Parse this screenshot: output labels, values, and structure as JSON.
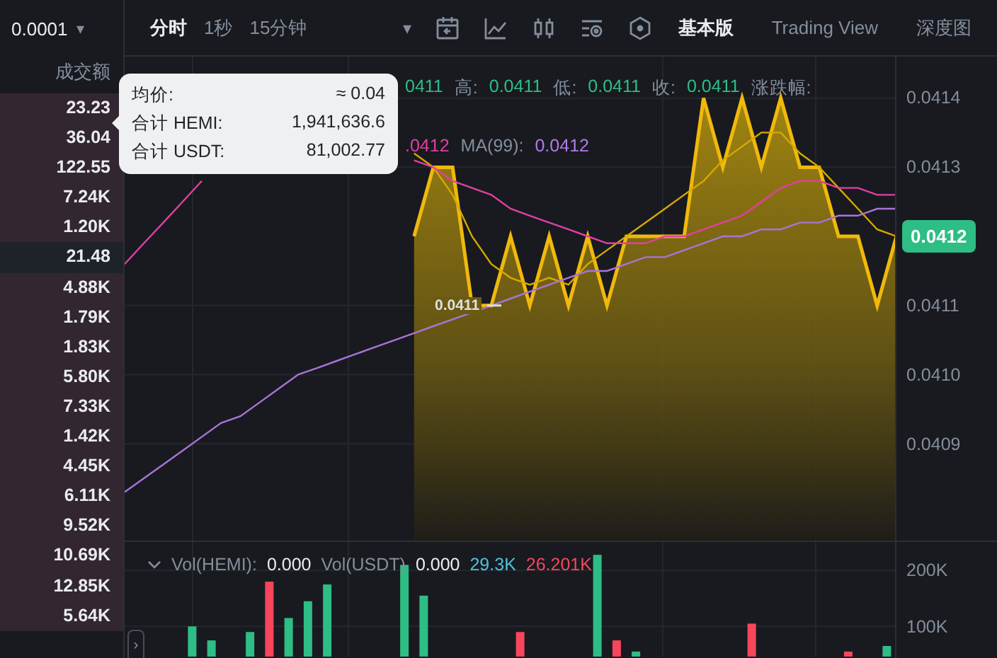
{
  "precision": {
    "value": "0.0001",
    "caret": "▾"
  },
  "trades": {
    "column": "成交额",
    "rows": [
      {
        "value": "23.23",
        "selected": false
      },
      {
        "value": "36.04",
        "selected": false
      },
      {
        "value": "122.55",
        "selected": false
      },
      {
        "value": "7.24K",
        "selected": false
      },
      {
        "value": "1.20K",
        "selected": false
      },
      {
        "value": "21.48",
        "selected": true
      },
      {
        "value": "4.88K",
        "selected": false
      },
      {
        "value": "1.79K",
        "selected": false
      },
      {
        "value": "1.83K",
        "selected": false
      },
      {
        "value": "5.80K",
        "selected": false
      },
      {
        "value": "7.33K",
        "selected": false
      },
      {
        "value": "1.42K",
        "selected": false
      },
      {
        "value": "4.45K",
        "selected": false
      },
      {
        "value": "6.11K",
        "selected": false
      },
      {
        "value": "9.52K",
        "selected": false
      },
      {
        "value": "10.69K",
        "selected": false
      },
      {
        "value": "12.85K",
        "selected": false
      },
      {
        "value": "5.64K",
        "selected": false
      }
    ]
  },
  "intervals": [
    {
      "label": "分时",
      "selected": true
    },
    {
      "label": "1秒",
      "selected": false
    },
    {
      "label": "15分钟",
      "selected": false
    }
  ],
  "interval_caret": "▾",
  "tools": [
    {
      "kind": "calendar"
    },
    {
      "kind": "indicator"
    },
    {
      "kind": "candles"
    },
    {
      "kind": "settings"
    },
    {
      "kind": "hexagon"
    }
  ],
  "views": [
    {
      "label": "基本版",
      "selected": true
    },
    {
      "label": "Trading View",
      "selected": false
    },
    {
      "label": "深度图",
      "selected": false
    }
  ],
  "legend_rows": [
    [
      {
        "text": "0411",
        "color": "#2ebd85"
      },
      {
        "text": "高:",
        "color": "#848e9c"
      },
      {
        "text": "0.0411",
        "color": "#2ebd85"
      },
      {
        "text": "低:",
        "color": "#848e9c"
      },
      {
        "text": "0.0411",
        "color": "#2ebd85"
      },
      {
        "text": "收:",
        "color": "#848e9c"
      },
      {
        "text": "0.0411",
        "color": "#2ebd85"
      },
      {
        "text": "涨跌幅:",
        "color": "#848e9c"
      }
    ],
    [
      {
        "text": ".0412",
        "color": "#e040a0"
      },
      {
        "text": "MA(99):",
        "color": "#848e9c"
      },
      {
        "text": "0.0412",
        "color": "#b07ce8"
      }
    ]
  ],
  "tooltip": {
    "rows": [
      {
        "label": "均价:",
        "value": "≈ 0.04"
      },
      {
        "label": "合计 HEMI:",
        "value": "1,941,636.6"
      },
      {
        "label": "合计 USDT:",
        "value": "81,002.77"
      }
    ]
  },
  "last_price_label": "0.0411",
  "current_price": "0.0412",
  "price_chart": {
    "chart_data": {
      "type": "area",
      "grid": true,
      "ylim": [
        0.04076,
        0.04146
      ],
      "yticks": [
        {
          "value": 0.0414,
          "label": "0.0414"
        },
        {
          "value": 0.0413,
          "label": "0.0413"
        },
        {
          "value": 0.0411,
          "label": "0.0411"
        },
        {
          "value": 0.041,
          "label": "0.0410"
        },
        {
          "value": 0.0409,
          "label": "0.0409"
        }
      ],
      "series": [
        {
          "color": "#f0b90b",
          "values": [
            null,
            null,
            null,
            null,
            null,
            null,
            null,
            null,
            null,
            null,
            null,
            null,
            null,
            null,
            null,
            0.0412,
            0.0413,
            0.0413,
            0.0411,
            0.0411,
            0.0412,
            0.0411,
            0.0412,
            0.0411,
            0.0412,
            0.0411,
            0.0412,
            0.0412,
            0.0412,
            0.0412,
            0.0414,
            0.0413,
            0.0414,
            0.0413,
            0.0414,
            0.0413,
            0.0413,
            0.0412,
            0.0412,
            0.0411,
            0.0412
          ]
        },
        {
          "type": "line",
          "color": "#d8a800",
          "values": [
            null,
            null,
            null,
            null,
            null,
            null,
            null,
            null,
            null,
            null,
            null,
            null,
            null,
            null,
            null,
            0.04132,
            0.0413,
            0.04126,
            0.0412,
            0.04116,
            0.04114,
            0.04113,
            0.04114,
            0.04113,
            0.04116,
            0.04118,
            0.0412,
            0.04122,
            0.04124,
            0.04126,
            0.04128,
            0.04131,
            0.04133,
            0.04135,
            0.04135,
            0.04132,
            0.0413,
            0.04127,
            0.04124,
            0.04121,
            0.0412
          ]
        },
        {
          "type": "line",
          "color": "#e040a0",
          "values": [
            0.04116,
            0.04119,
            0.04122,
            0.04125,
            0.04128,
            null,
            null,
            null,
            null,
            null,
            null,
            null,
            null,
            null,
            null,
            0.04131,
            0.0413,
            0.04128,
            0.04127,
            0.04126,
            0.04124,
            0.04123,
            0.04122,
            0.04121,
            0.0412,
            0.04119,
            0.04119,
            0.04119,
            0.0412,
            0.0412,
            0.04121,
            0.04122,
            0.04123,
            0.04125,
            0.04127,
            0.04128,
            0.04128,
            0.04127,
            0.04127,
            0.04126,
            0.04126
          ]
        },
        {
          "type": "line",
          "color": "#a874d8",
          "values": [
            0.04083,
            0.04085,
            0.04087,
            0.04089,
            0.04091,
            0.04093,
            0.04094,
            0.04096,
            0.04098,
            0.041,
            0.04101,
            0.04102,
            0.04103,
            0.04104,
            0.04105,
            0.04106,
            0.04107,
            0.04108,
            0.04109,
            0.0411,
            0.04111,
            0.04112,
            0.04113,
            0.04114,
            0.04115,
            0.04115,
            0.04116,
            0.04117,
            0.04117,
            0.04118,
            0.04119,
            0.0412,
            0.0412,
            0.04121,
            0.04121,
            0.04122,
            0.04122,
            0.04123,
            0.04123,
            0.04124,
            0.04124
          ]
        }
      ]
    }
  },
  "volume": {
    "legend": [
      {
        "text": "Vol(HEMI):",
        "color": "#848e9c"
      },
      {
        "text": "0.000",
        "color": "#eaecef"
      },
      {
        "text": "Vol(USDT)",
        "color": "#848e9c"
      },
      {
        "text": "0.000",
        "color": "#eaecef"
      },
      {
        "text": "29.3K",
        "color": "#4fc3dc"
      },
      {
        "text": "26.201K",
        "color": "#f6465d"
      }
    ],
    "chart_data": {
      "type": "bar",
      "grid": true,
      "ylim": [
        46000,
        251000
      ],
      "yticks": [
        {
          "value": 200000,
          "label": "200K"
        },
        {
          "value": 100000,
          "label": "100K"
        }
      ],
      "series": [
        {
          "color": "#2ebd85",
          "values": [
            null,
            null,
            null,
            100000,
            75000,
            null,
            90000,
            null,
            115000,
            145000,
            175000,
            null,
            null,
            null,
            210000,
            155000,
            null,
            null,
            null,
            null,
            null,
            null,
            null,
            null,
            228000,
            null,
            55000,
            null,
            null,
            null,
            null,
            null,
            null,
            null,
            null,
            null,
            null,
            null,
            null,
            65000
          ]
        },
        {
          "color": "#f6465d",
          "values": [
            null,
            null,
            null,
            null,
            null,
            null,
            null,
            180000,
            null,
            null,
            null,
            null,
            null,
            null,
            null,
            null,
            null,
            null,
            null,
            null,
            90000,
            null,
            null,
            null,
            null,
            75000,
            null,
            null,
            null,
            null,
            null,
            null,
            105000,
            null,
            null,
            null,
            null,
            55000,
            null,
            null
          ]
        }
      ]
    }
  },
  "expand_button": "›"
}
